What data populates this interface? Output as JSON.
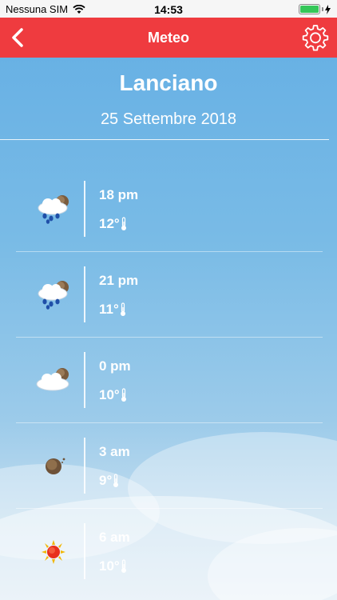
{
  "status_bar": {
    "carrier": "Nessuna SIM",
    "time": "14:53",
    "battery_color": "#35c759"
  },
  "nav": {
    "title": "Meteo",
    "accent": "#ef3b3f"
  },
  "location": {
    "city": "Lanciano",
    "date": "25 Settembre 2018"
  },
  "forecast": [
    {
      "hour": "18 pm",
      "temp": "12°",
      "icon": "rain-cloud-moon-icon"
    },
    {
      "hour": "21 pm",
      "temp": "11°",
      "icon": "rain-cloud-moon-icon"
    },
    {
      "hour": "0 pm",
      "temp": "10°",
      "icon": "cloud-moon-icon"
    },
    {
      "hour": "3 am",
      "temp": "9°",
      "icon": "moon-icon"
    },
    {
      "hour": "6 am",
      "temp": "10°",
      "icon": "sun-icon"
    }
  ]
}
